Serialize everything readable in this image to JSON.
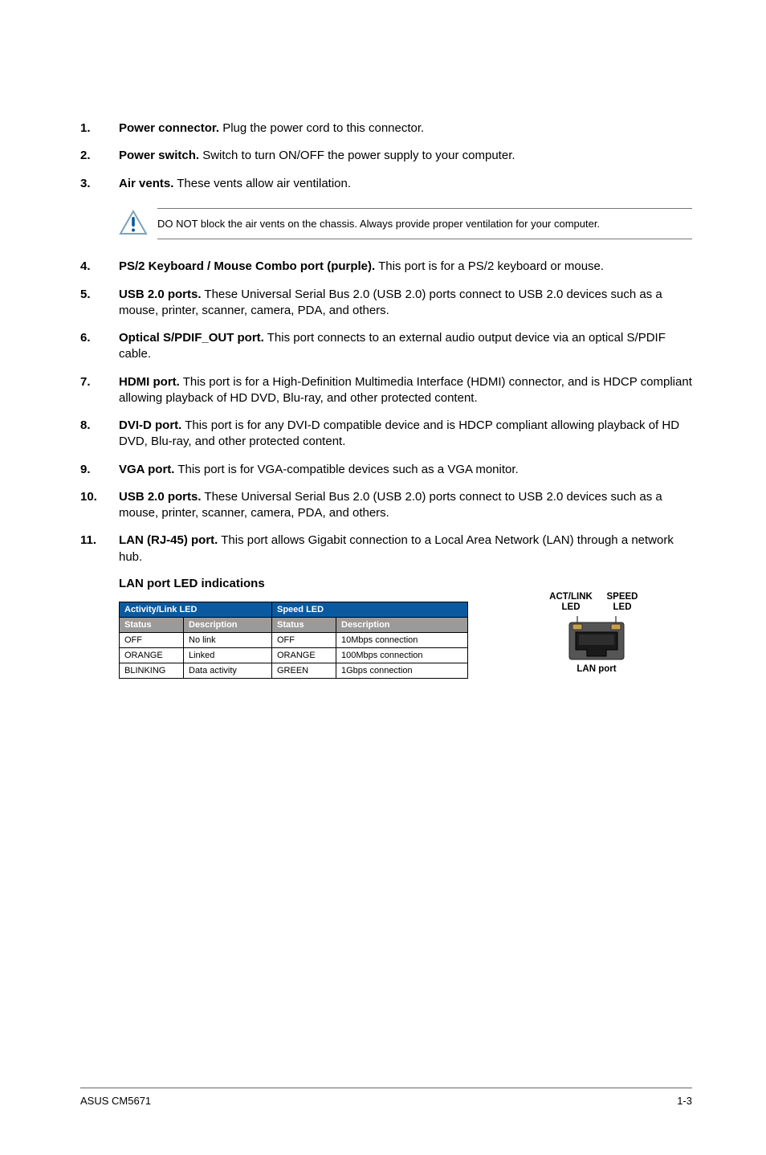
{
  "list1": [
    {
      "num": "1.",
      "bold": "Power connector.",
      "text": " Plug the power cord to this connector."
    },
    {
      "num": "2.",
      "bold": "Power switch.",
      "text": " Switch to turn ON/OFF the power supply to your computer."
    },
    {
      "num": "3.",
      "bold": "Air vents.",
      "text": " These vents allow air ventilation."
    }
  ],
  "callout": "DO NOT block the air vents on the chassis. Always provide proper ventilation for your computer.",
  "list2": [
    {
      "num": "4.",
      "bold": "PS/2 Keyboard / Mouse Combo port (purple).",
      "text": " This port is for a PS/2 keyboard or mouse."
    },
    {
      "num": "5.",
      "bold": "USB 2.0 ports.",
      "text": " These Universal Serial Bus 2.0 (USB 2.0) ports connect to USB 2.0 devices such as a mouse, printer, scanner, camera, PDA, and others."
    },
    {
      "num": "6.",
      "bold": "Optical S/PDIF_OUT port.",
      "text": " This port connects to an external audio output device via an optical S/PDIF cable."
    },
    {
      "num": "7.",
      "bold": "HDMI port.",
      "text": " This port is for a High-Definition Multimedia Interface (HDMI) connector, and is HDCP compliant allowing playback of HD DVD, Blu-ray, and other protected content."
    },
    {
      "num": "8.",
      "bold": "DVI-D port.",
      "text": " This port is for any DVI-D compatible device and is HDCP compliant allowing playback of HD DVD, Blu-ray, and other protected content."
    },
    {
      "num": "9.",
      "bold": "VGA port.",
      "text": " This port is for VGA-compatible devices such as a VGA monitor."
    },
    {
      "num": "10.",
      "bold": "USB 2.0 ports.",
      "text": " These Universal Serial Bus 2.0 (USB 2.0) ports connect to USB 2.0 devices such as a mouse, printer, scanner, camera, PDA, and others."
    },
    {
      "num": "11.",
      "bold": "LAN (RJ-45) port.",
      "text": " This port allows Gigabit connection to a Local Area Network (LAN) through a network hub."
    }
  ],
  "led_heading": "LAN port LED indications",
  "table": {
    "group1": "Activity/Link LED",
    "group2": "Speed LED",
    "sub1": "Status",
    "sub2": "Description",
    "sub3": "Status",
    "sub4": "Description",
    "rows": [
      [
        "OFF",
        "No link",
        "OFF",
        "10Mbps connection"
      ],
      [
        "ORANGE",
        "Linked",
        "ORANGE",
        "100Mbps connection"
      ],
      [
        "BLINKING",
        "Data activity",
        "GREEN",
        "1Gbps connection"
      ]
    ]
  },
  "figure": {
    "left_top": "ACT/LINK",
    "left_bot": "LED",
    "right_top": "SPEED",
    "right_bot": "LED",
    "caption": "LAN port"
  },
  "footer_left": "ASUS CM5671",
  "footer_right": "1-3"
}
